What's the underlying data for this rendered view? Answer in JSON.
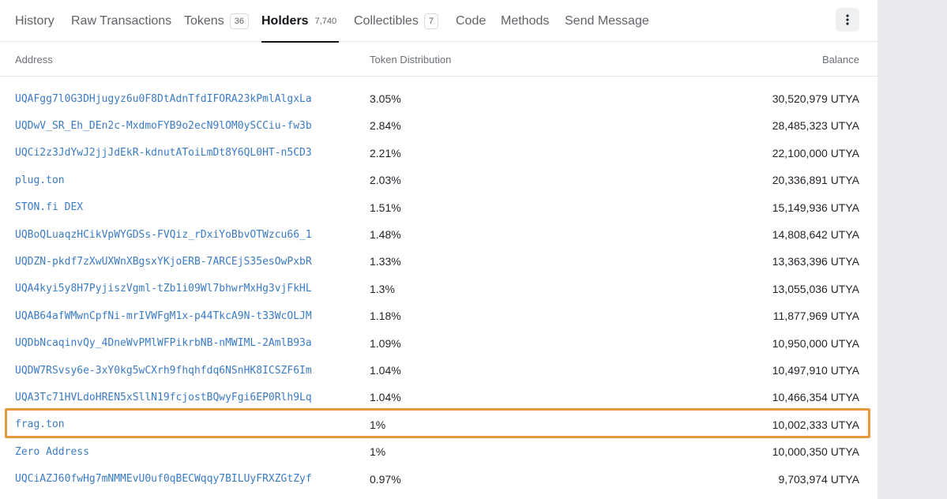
{
  "tabs": [
    {
      "label": "History"
    },
    {
      "label": "Raw Transactions"
    },
    {
      "label": "Tokens",
      "count": "36"
    },
    {
      "label": "Holders",
      "count": "7,740"
    },
    {
      "label": "Collectibles",
      "count": "7"
    },
    {
      "label": "Code"
    },
    {
      "label": "Methods"
    },
    {
      "label": "Send Message"
    }
  ],
  "active_tab": "Holders",
  "table": {
    "headers": {
      "address": "Address",
      "distribution": "Token Distribution",
      "balance": "Balance"
    },
    "rows": [
      {
        "address": "UQAFgg7l0G3DHjugyz6u0F8DtAdnTfdIFORA23kPmlAlgxLa",
        "distribution": "3.05%",
        "balance": "30,520,979 UTYA"
      },
      {
        "address": "UQDwV_SR_Eh_DEn2c-MxdmoFYB9o2ecN9lOM0ySCCiu-fw3b",
        "distribution": "2.84%",
        "balance": "28,485,323 UTYA"
      },
      {
        "address": "UQCi2z3JdYwJ2jjJdEkR-kdnutAToiLmDt8Y6QL0HT-n5CD3",
        "distribution": "2.21%",
        "balance": "22,100,000 UTYA"
      },
      {
        "address": "plug.ton",
        "distribution": "2.03%",
        "balance": "20,336,891 UTYA"
      },
      {
        "address": "STON.fi DEX",
        "distribution": "1.51%",
        "balance": "15,149,936 UTYA"
      },
      {
        "address": "UQBoQLuaqzHCikVpWYGDSs-FVQiz_rDxiYoBbvOTWzcu66_1",
        "distribution": "1.48%",
        "balance": "14,808,642 UTYA"
      },
      {
        "address": "UQDZN-pkdf7zXwUXWnXBgsxYKjoERB-7ARCEjS35esOwPxbR",
        "distribution": "1.33%",
        "balance": "13,363,396 UTYA"
      },
      {
        "address": "UQA4kyi5y8H7PyjiszVgml-tZb1i09Wl7bhwrMxHg3vjFkHL",
        "distribution": "1.3%",
        "balance": "13,055,036 UTYA"
      },
      {
        "address": "UQAB64afWMwnCpfNi-mrIVWFgM1x-p44TkcA9N-t33WcOLJM",
        "distribution": "1.18%",
        "balance": "11,877,969 UTYA"
      },
      {
        "address": "UQDbNcaqinvQy_4DneWvPMlWFPikrbNB-nMWIML-2AmlB93a",
        "distribution": "1.09%",
        "balance": "10,950,000 UTYA"
      },
      {
        "address": "UQDW7RSvsy6e-3xY0kg5wCXrh9fhqhfdq6NSnHK8ICSZF6Im",
        "distribution": "1.04%",
        "balance": "10,497,910 UTYA"
      },
      {
        "address": "UQA3Tc71HVLdoHREN5xSllN19fcjostBQwyFgi6EP0Rlh9Lq",
        "distribution": "1.04%",
        "balance": "10,466,354 UTYA"
      },
      {
        "address": "frag.ton",
        "distribution": "1%",
        "balance": "10,002,333 UTYA",
        "highlighted": true
      },
      {
        "address": "Zero Address",
        "distribution": "1%",
        "balance": "10,000,350 UTYA"
      },
      {
        "address": "UQCiAZJ60fwHg7mNMMEvU0uf0qBECWqqy7BILUyFRXZGtZyf",
        "distribution": "0.97%",
        "balance": "9,703,974 UTYA"
      }
    ]
  },
  "colors": {
    "link": "#3b7bc4",
    "highlight": "#e8993e",
    "active_tab": "#111418"
  },
  "icons": {
    "more": "vertical-dots-icon"
  }
}
